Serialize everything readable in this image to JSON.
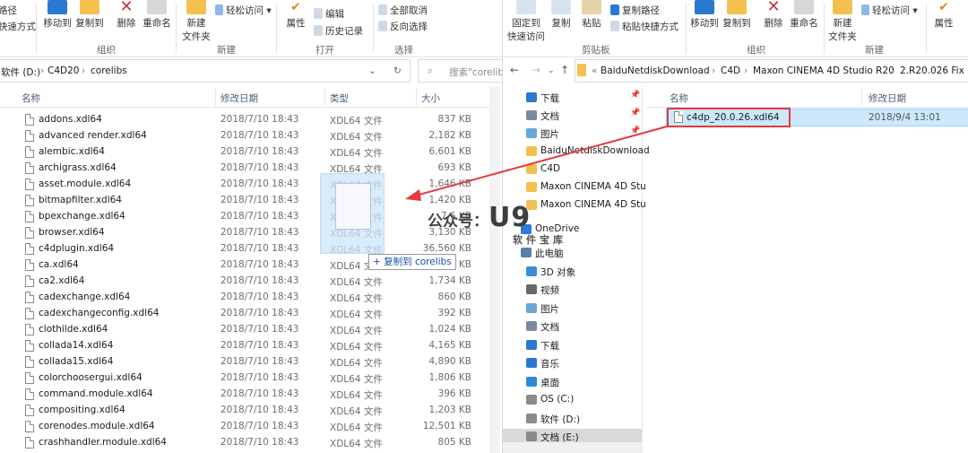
{
  "left": {
    "ribbon": {
      "path_label": "路径",
      "shortcut_label": "快速方式",
      "move_to": "移动到",
      "copy_to": "复制到",
      "delete": "删除",
      "rename": "重命名",
      "new_folder": "新建\n文件夹",
      "easy_access": "轻松访问",
      "properties": "属性",
      "edit": "编辑",
      "history": "历史记录",
      "select_none": "全部取消",
      "invert_selection": "反向选择",
      "group_organize": "组织",
      "group_new": "新建",
      "group_open": "打开",
      "group_select": "选择"
    },
    "address": {
      "segments": [
        "软件 (D:)",
        "C4D20",
        "corelibs"
      ],
      "search_placeholder": "搜索\"corelib"
    },
    "columns": {
      "name": "名称",
      "date": "修改日期",
      "type": "类型",
      "size": "大小"
    },
    "files": [
      {
        "name": "addons.xdl64",
        "date": "2018/7/10 18:43",
        "type": "XDL64 文件",
        "size": "837 KB"
      },
      {
        "name": "advanced render.xdl64",
        "date": "2018/7/10 18:43",
        "type": "XDL64 文件",
        "size": "2,182 KB"
      },
      {
        "name": "alembic.xdl64",
        "date": "2018/7/10 18:43",
        "type": "XDL64 文件",
        "size": "6,601 KB"
      },
      {
        "name": "archigrass.xdl64",
        "date": "2018/7/10 18:43",
        "type": "XDL64 文件",
        "size": "693 KB"
      },
      {
        "name": "asset.module.xdl64",
        "date": "2018/7/10 18:43",
        "type": "XDL64 文件",
        "size": "1,646 KB"
      },
      {
        "name": "bitmapfilter.xdl64",
        "date": "2018/7/10 18:43",
        "type": "XDL64 文件",
        "size": "1,420 KB"
      },
      {
        "name": "bpexchange.xdl64",
        "date": "2018/7/10 18:43",
        "type": "XDL64 文件",
        "size": "7,6 KB"
      },
      {
        "name": "browser.xdl64",
        "date": "2018/7/10 18:43",
        "type": "XDL64 文件",
        "size": "3,130 KB"
      },
      {
        "name": "c4dplugin.xdl64",
        "date": "2018/7/10 18:43",
        "type": "XDL64 文件",
        "size": "36,560 KB"
      },
      {
        "name": "ca.xdl64",
        "date": "2018/7/10 18:43",
        "type": "XDL64 文件",
        "size": "2 KB"
      },
      {
        "name": "ca2.xdl64",
        "date": "2018/7/10 18:43",
        "type": "XDL64 文件",
        "size": "1,734 KB"
      },
      {
        "name": "cadexchange.xdl64",
        "date": "2018/7/10 18:43",
        "type": "XDL64 文件",
        "size": "860 KB"
      },
      {
        "name": "cadexchangeconfig.xdl64",
        "date": "2018/7/10 18:43",
        "type": "XDL64 文件",
        "size": "392 KB"
      },
      {
        "name": "clothilde.xdl64",
        "date": "2018/7/10 18:43",
        "type": "XDL64 文件",
        "size": "1,024 KB"
      },
      {
        "name": "collada14.xdl64",
        "date": "2018/7/10 18:43",
        "type": "XDL64 文件",
        "size": "4,165 KB"
      },
      {
        "name": "collada15.xdl64",
        "date": "2018/7/10 18:43",
        "type": "XDL64 文件",
        "size": "4,890 KB"
      },
      {
        "name": "colorchoosergui.xdl64",
        "date": "2018/7/10 18:43",
        "type": "XDL64 文件",
        "size": "1,806 KB"
      },
      {
        "name": "command.module.xdl64",
        "date": "2018/7/10 18:43",
        "type": "XDL64 文件",
        "size": "396 KB"
      },
      {
        "name": "compositing.xdl64",
        "date": "2018/7/10 18:43",
        "type": "XDL64 文件",
        "size": "1,203 KB"
      },
      {
        "name": "corenodes.module.xdl64",
        "date": "2018/7/10 18:43",
        "type": "XDL64 文件",
        "size": "12,501 KB"
      },
      {
        "name": "crashhandler.module.xdl64",
        "date": "2018/7/10 18:43",
        "type": "XDL64 文件",
        "size": "805 KB"
      }
    ],
    "drag_tooltip": "+ 复制到 corelibs"
  },
  "right": {
    "ribbon": {
      "pin_label": "固定到\n快速访问",
      "copy": "复制",
      "paste": "粘贴",
      "copy_path": "复制路径",
      "paste_shortcut": "粘贴快捷方式",
      "move_to": "移动到",
      "copy_to": "复制到",
      "delete": "删除",
      "rename": "重命名",
      "new_folder": "新建\n文件夹",
      "easy_access": "轻松访问",
      "properties": "属性",
      "group_clipboard": "剪贴板",
      "group_organize": "组织",
      "group_new": "新建"
    },
    "address": {
      "segments": [
        "BaiduNetdiskDownload",
        "C4D",
        "Maxon CINEMA 4D Studio R20",
        "2.R20.026 Fix"
      ]
    },
    "nav_items": [
      "下载",
      "文档",
      "图片",
      "BaiduNetdiskDownload",
      "C4D",
      "Maxon CINEMA 4D Stu",
      "Maxon CINEMA 4D Stu",
      "OneDrive",
      "此电脑",
      "3D 对象",
      "视频",
      "图片",
      "文档",
      "下载",
      "音乐",
      "桌面",
      "OS (C:)",
      "软件 (D:)",
      "文档 (E:)"
    ],
    "columns": {
      "name": "名称",
      "date": "修改日期"
    },
    "files": [
      {
        "name": "c4dp_20.0.26.xdl64",
        "date": "2018/9/4 13:01"
      }
    ]
  },
  "watermark": {
    "line1": "公众号：",
    "brand": "U9",
    "line2": "软件宝库"
  },
  "colors": {
    "accent_red": "#e23b3b",
    "selection": "#cce8ff",
    "folder": "#f4c04e"
  }
}
